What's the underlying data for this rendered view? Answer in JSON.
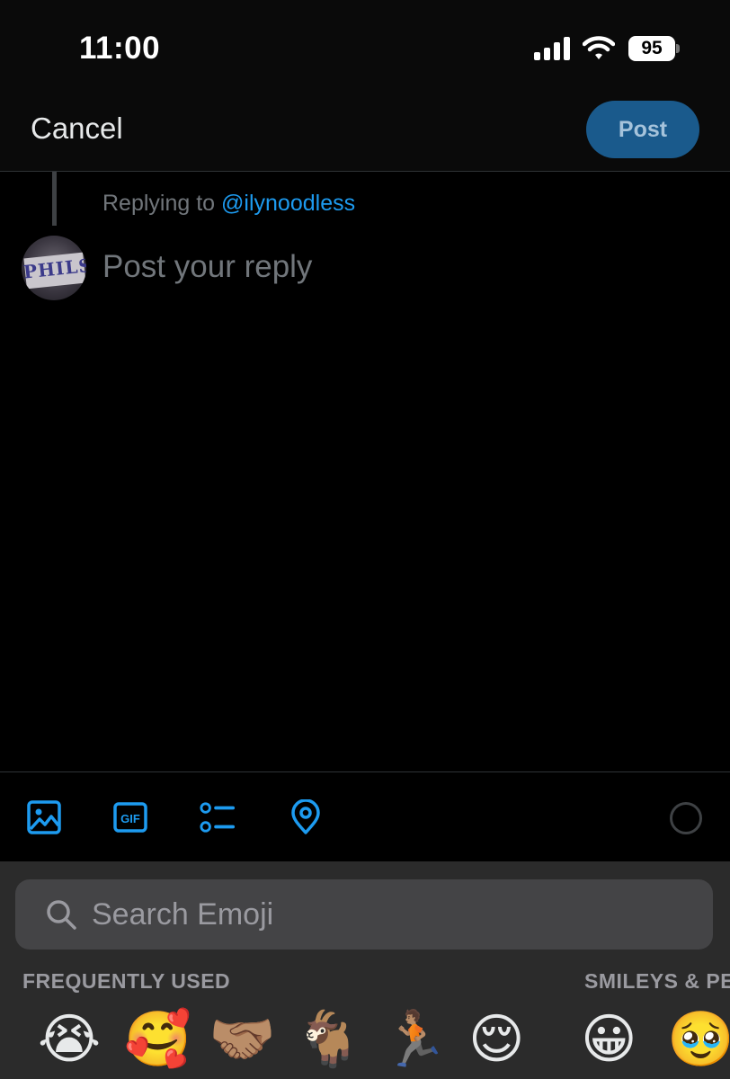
{
  "status_bar": {
    "time": "11:00",
    "battery": "95"
  },
  "header": {
    "cancel_label": "Cancel",
    "post_label": "Post"
  },
  "reply": {
    "replying_prefix": "Replying to",
    "handle": "@ilynoodless",
    "placeholder": "Post your reply",
    "avatar_text": "PHILS"
  },
  "toolbar": {
    "icons": [
      "image-icon",
      "gif-icon",
      "poll-icon",
      "location-icon",
      "character-count-ring"
    ],
    "gif_label": "GIF",
    "accent_color": "#1d9bf0"
  },
  "emoji_keyboard": {
    "search_placeholder": "Search Emoji",
    "sections": [
      "FREQUENTLY USED",
      "SMILEYS & PE"
    ],
    "emojis": [
      "😭",
      "🥰",
      "🤝🏽",
      "🐐",
      "🏃🏽",
      "😌",
      "😀",
      "🥹"
    ]
  }
}
